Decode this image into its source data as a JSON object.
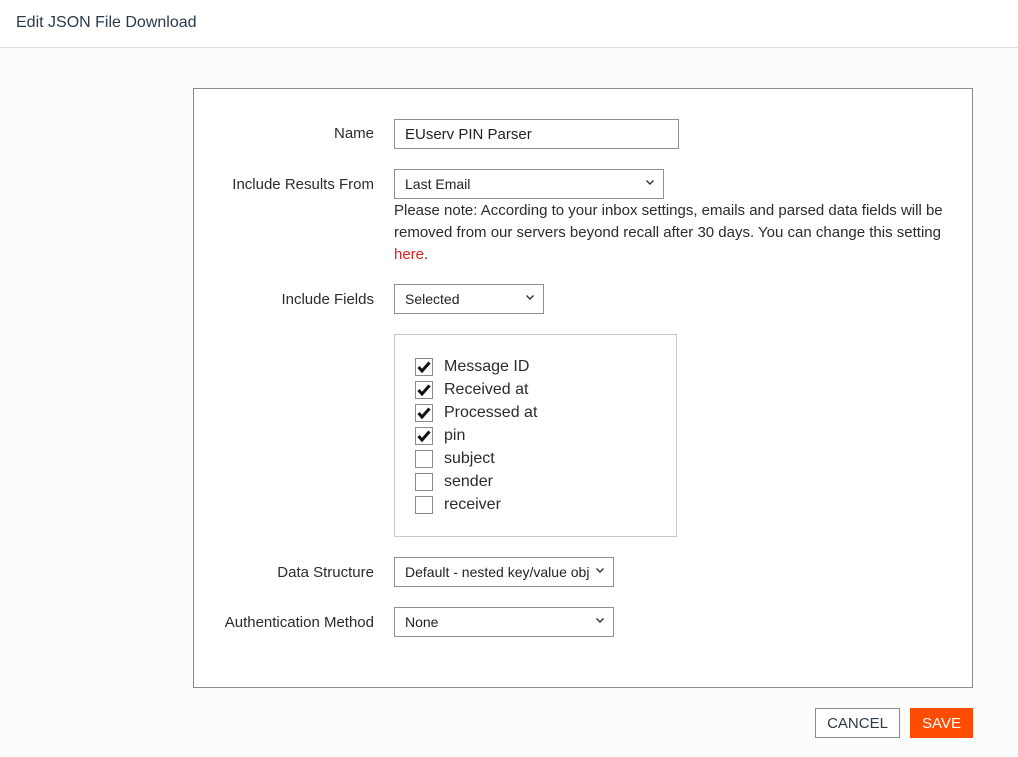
{
  "header": {
    "title": "Edit JSON File Download"
  },
  "form": {
    "name": {
      "label": "Name",
      "value": "EUserv PIN Parser"
    },
    "include_results_from": {
      "label": "Include Results From",
      "selected": "Last Email",
      "note_text": "Please note: According to your inbox settings, emails and parsed data fields will be removed from our servers beyond recall after 30 days. You can change this setting ",
      "note_link": "here",
      "note_end": "."
    },
    "include_fields": {
      "label": "Include Fields",
      "selected": "Selected",
      "options": [
        {
          "label": "Message ID",
          "checked": true
        },
        {
          "label": "Received at",
          "checked": true
        },
        {
          "label": "Processed at",
          "checked": true
        },
        {
          "label": "pin",
          "checked": true
        },
        {
          "label": "subject",
          "checked": false
        },
        {
          "label": "sender",
          "checked": false
        },
        {
          "label": "receiver",
          "checked": false
        }
      ]
    },
    "data_structure": {
      "label": "Data Structure",
      "selected": "Default - nested key/value obj"
    },
    "authentication_method": {
      "label": "Authentication Method",
      "selected": "None"
    }
  },
  "actions": {
    "cancel_label": "CANCEL",
    "save_label": "SAVE"
  },
  "colors": {
    "accent": "#ff4c00",
    "link": "#e02020"
  }
}
